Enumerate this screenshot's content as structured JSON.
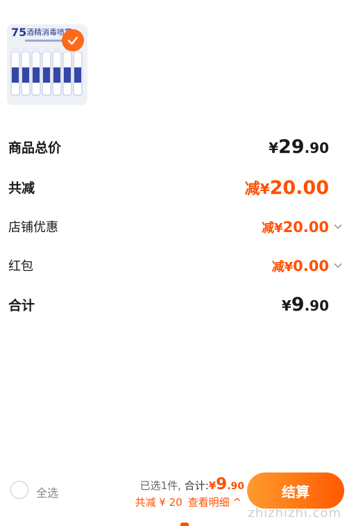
{
  "product": {
    "thumbnail_text_badge": "75",
    "thumbnail_text_title": "酒精消毒喷雾"
  },
  "summary": {
    "goods_total": {
      "label": "商品总价",
      "yen": "¥",
      "int": "29",
      "dec": ".90"
    },
    "total_discount": {
      "label": "共减",
      "prefix": "减",
      "yen": "¥",
      "int": "20",
      "dec": ".00"
    },
    "shop_discount": {
      "label": "店铺优惠",
      "prefix": "减",
      "yen": "¥",
      "int": "20",
      "dec": ".00"
    },
    "red_packet": {
      "label": "红包",
      "prefix": "减",
      "yen": "¥",
      "int": "0",
      "dec": ".00"
    },
    "grand_total": {
      "label": "合计",
      "yen": "¥",
      "int": "9",
      "dec": ".90"
    }
  },
  "bottom_bar": {
    "select_all": "全选",
    "selected_count": "已选1件,",
    "total_label": "合计:",
    "total_yen": "¥",
    "total_int": "9",
    "total_dec": ".90",
    "discount_text": "共减 ¥ 20",
    "detail_link": "查看明细 ^",
    "checkout_label": "结算",
    "watermark": "zhizhizhi.com"
  },
  "colors": {
    "accent": "#ff5000",
    "checkout_start": "#ff9a2e",
    "checkout_end": "#ff5a00"
  }
}
